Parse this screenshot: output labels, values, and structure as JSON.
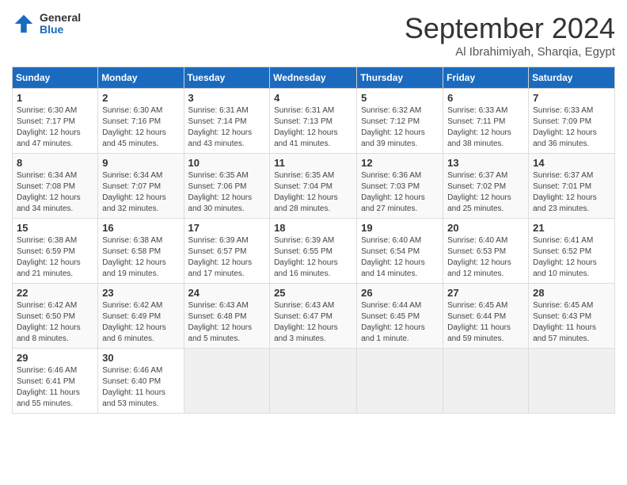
{
  "logo": {
    "general": "General",
    "blue": "Blue"
  },
  "title": "September 2024",
  "location": "Al Ibrahimiyah, Sharqia, Egypt",
  "weekdays": [
    "Sunday",
    "Monday",
    "Tuesday",
    "Wednesday",
    "Thursday",
    "Friday",
    "Saturday"
  ],
  "weeks": [
    [
      {
        "day": "1",
        "info": "Sunrise: 6:30 AM\nSunset: 7:17 PM\nDaylight: 12 hours\nand 47 minutes."
      },
      {
        "day": "2",
        "info": "Sunrise: 6:30 AM\nSunset: 7:16 PM\nDaylight: 12 hours\nand 45 minutes."
      },
      {
        "day": "3",
        "info": "Sunrise: 6:31 AM\nSunset: 7:14 PM\nDaylight: 12 hours\nand 43 minutes."
      },
      {
        "day": "4",
        "info": "Sunrise: 6:31 AM\nSunset: 7:13 PM\nDaylight: 12 hours\nand 41 minutes."
      },
      {
        "day": "5",
        "info": "Sunrise: 6:32 AM\nSunset: 7:12 PM\nDaylight: 12 hours\nand 39 minutes."
      },
      {
        "day": "6",
        "info": "Sunrise: 6:33 AM\nSunset: 7:11 PM\nDaylight: 12 hours\nand 38 minutes."
      },
      {
        "day": "7",
        "info": "Sunrise: 6:33 AM\nSunset: 7:09 PM\nDaylight: 12 hours\nand 36 minutes."
      }
    ],
    [
      {
        "day": "8",
        "info": "Sunrise: 6:34 AM\nSunset: 7:08 PM\nDaylight: 12 hours\nand 34 minutes."
      },
      {
        "day": "9",
        "info": "Sunrise: 6:34 AM\nSunset: 7:07 PM\nDaylight: 12 hours\nand 32 minutes."
      },
      {
        "day": "10",
        "info": "Sunrise: 6:35 AM\nSunset: 7:06 PM\nDaylight: 12 hours\nand 30 minutes."
      },
      {
        "day": "11",
        "info": "Sunrise: 6:35 AM\nSunset: 7:04 PM\nDaylight: 12 hours\nand 28 minutes."
      },
      {
        "day": "12",
        "info": "Sunrise: 6:36 AM\nSunset: 7:03 PM\nDaylight: 12 hours\nand 27 minutes."
      },
      {
        "day": "13",
        "info": "Sunrise: 6:37 AM\nSunset: 7:02 PM\nDaylight: 12 hours\nand 25 minutes."
      },
      {
        "day": "14",
        "info": "Sunrise: 6:37 AM\nSunset: 7:01 PM\nDaylight: 12 hours\nand 23 minutes."
      }
    ],
    [
      {
        "day": "15",
        "info": "Sunrise: 6:38 AM\nSunset: 6:59 PM\nDaylight: 12 hours\nand 21 minutes."
      },
      {
        "day": "16",
        "info": "Sunrise: 6:38 AM\nSunset: 6:58 PM\nDaylight: 12 hours\nand 19 minutes."
      },
      {
        "day": "17",
        "info": "Sunrise: 6:39 AM\nSunset: 6:57 PM\nDaylight: 12 hours\nand 17 minutes."
      },
      {
        "day": "18",
        "info": "Sunrise: 6:39 AM\nSunset: 6:55 PM\nDaylight: 12 hours\nand 16 minutes."
      },
      {
        "day": "19",
        "info": "Sunrise: 6:40 AM\nSunset: 6:54 PM\nDaylight: 12 hours\nand 14 minutes."
      },
      {
        "day": "20",
        "info": "Sunrise: 6:40 AM\nSunset: 6:53 PM\nDaylight: 12 hours\nand 12 minutes."
      },
      {
        "day": "21",
        "info": "Sunrise: 6:41 AM\nSunset: 6:52 PM\nDaylight: 12 hours\nand 10 minutes."
      }
    ],
    [
      {
        "day": "22",
        "info": "Sunrise: 6:42 AM\nSunset: 6:50 PM\nDaylight: 12 hours\nand 8 minutes."
      },
      {
        "day": "23",
        "info": "Sunrise: 6:42 AM\nSunset: 6:49 PM\nDaylight: 12 hours\nand 6 minutes."
      },
      {
        "day": "24",
        "info": "Sunrise: 6:43 AM\nSunset: 6:48 PM\nDaylight: 12 hours\nand 5 minutes."
      },
      {
        "day": "25",
        "info": "Sunrise: 6:43 AM\nSunset: 6:47 PM\nDaylight: 12 hours\nand 3 minutes."
      },
      {
        "day": "26",
        "info": "Sunrise: 6:44 AM\nSunset: 6:45 PM\nDaylight: 12 hours\nand 1 minute."
      },
      {
        "day": "27",
        "info": "Sunrise: 6:45 AM\nSunset: 6:44 PM\nDaylight: 11 hours\nand 59 minutes."
      },
      {
        "day": "28",
        "info": "Sunrise: 6:45 AM\nSunset: 6:43 PM\nDaylight: 11 hours\nand 57 minutes."
      }
    ],
    [
      {
        "day": "29",
        "info": "Sunrise: 6:46 AM\nSunset: 6:41 PM\nDaylight: 11 hours\nand 55 minutes."
      },
      {
        "day": "30",
        "info": "Sunrise: 6:46 AM\nSunset: 6:40 PM\nDaylight: 11 hours\nand 53 minutes."
      },
      null,
      null,
      null,
      null,
      null
    ]
  ]
}
